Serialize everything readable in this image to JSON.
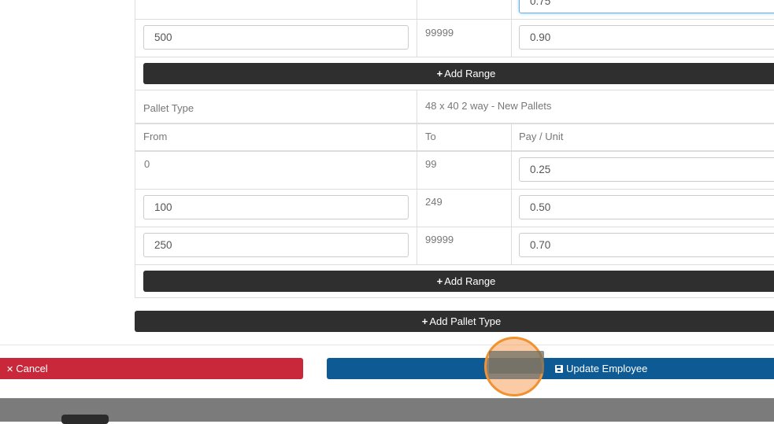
{
  "top_range": {
    "pay_value": "0.75",
    "last_row": {
      "from": "500",
      "to": "99999",
      "pay": "0.90"
    }
  },
  "buttons": {
    "add_range": "Add Range",
    "add_pallet_type": "Add Pallet Type",
    "cancel": "Cancel",
    "update_employee": "Update Employee"
  },
  "pallet": {
    "type_label": "Pallet Type",
    "type_value": "48 x 40 2 way - New Pallets",
    "headers": {
      "from": "From",
      "to": "To",
      "pay": "Pay / Unit"
    },
    "rows": [
      {
        "from": "0",
        "to": "99",
        "pay": "0.25"
      },
      {
        "from": "100",
        "to": "249",
        "pay": "0.50"
      },
      {
        "from": "250",
        "to": "99999",
        "pay": "0.70"
      }
    ]
  },
  "icons": {
    "plus": "+",
    "times": "✕",
    "save": "floppy-disk-icon"
  },
  "colors": {
    "dark_button": "#2f2f2f",
    "cancel_red": "#c9283a",
    "update_blue": "#0e5a94",
    "click_marker": "#f0922f"
  }
}
